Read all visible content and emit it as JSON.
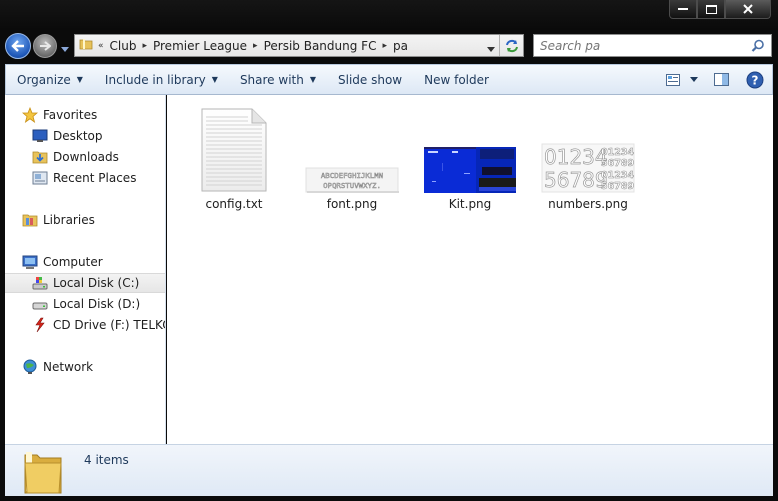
{
  "window": {
    "caption_buttons": [
      "minimize",
      "maximize",
      "close"
    ]
  },
  "navigation": {
    "breadcrumb": [
      "Club",
      "Premier League",
      "Persib Bandung FC",
      "pa"
    ],
    "overflow_chevron": "«",
    "search_placeholder": "Search pa"
  },
  "toolbar": {
    "organize": "Organize",
    "include_in_library": "Include in library",
    "share_with": "Share with",
    "slide_show": "Slide show",
    "new_folder": "New folder"
  },
  "sidebar": {
    "items": [
      {
        "label": "Favorites",
        "icon": "star-icon"
      },
      {
        "label": "Desktop",
        "icon": "desktop-icon"
      },
      {
        "label": "Downloads",
        "icon": "downloads-icon"
      },
      {
        "label": "Recent Places",
        "icon": "recent-places-icon"
      },
      {
        "label": "Libraries",
        "icon": "libraries-icon"
      },
      {
        "label": "Computer",
        "icon": "computer-icon"
      },
      {
        "label": "Local Disk (C:)",
        "icon": "drive-c-icon",
        "selected": true
      },
      {
        "label": "Local Disk (D:)",
        "icon": "drive-d-icon"
      },
      {
        "label": "CD Drive (F:) TELKOMSEL",
        "icon": "cd-drive-icon"
      },
      {
        "label": "Network",
        "icon": "network-icon"
      }
    ]
  },
  "files": [
    {
      "name": "config.txt",
      "type": "text-document"
    },
    {
      "name": "font.png",
      "type": "image",
      "preview_rows": [
        "ABCDEFGHIJKLMN",
        "OPQRSTUVWXYZ."
      ]
    },
    {
      "name": "Kit.png",
      "type": "image"
    },
    {
      "name": "numbers.png",
      "type": "image",
      "preview_rows": [
        "01234",
        "56789"
      ],
      "preview_small_rows": [
        "01234",
        "56789",
        "01234",
        "56789"
      ]
    }
  ],
  "details": {
    "item_count": "4 items"
  },
  "colors": {
    "kit_blue": "#0a2bd6",
    "toolbar_text": "#1e395b",
    "frame": "#0b0b0b"
  }
}
